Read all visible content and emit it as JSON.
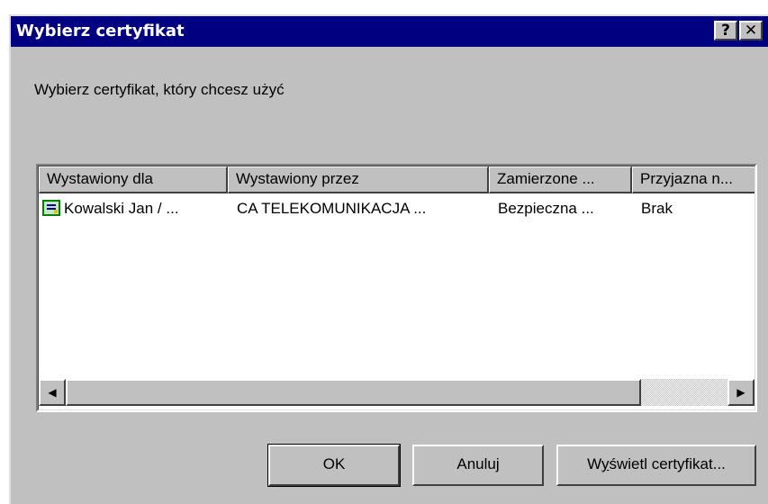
{
  "window": {
    "title": "Wybierz certyfikat",
    "help_button": "?",
    "close_button": "✕"
  },
  "prompt": "Wybierz certyfikat, który chcesz użyć",
  "list": {
    "columns": [
      "Wystawiony dla",
      "Wystawiony przez",
      "Zamierzone ...",
      "Przyjazna n..."
    ],
    "rows": [
      {
        "icon": "certificate-icon",
        "cells": [
          "Kowalski Jan / ...",
          "CA TELEKOMUNIKACJA ...",
          "Bezpieczna ...",
          "Brak"
        ]
      }
    ],
    "scroll_position": 0.0,
    "scroll_visible_fraction": 0.87
  },
  "buttons": {
    "ok": "OK",
    "cancel": "Anuluj",
    "view_prefix": "W",
    "view_accel": "y",
    "view_rest": "świetl certyfikat..."
  },
  "icons": {
    "scroll_left": "◀",
    "scroll_right": "▶"
  }
}
